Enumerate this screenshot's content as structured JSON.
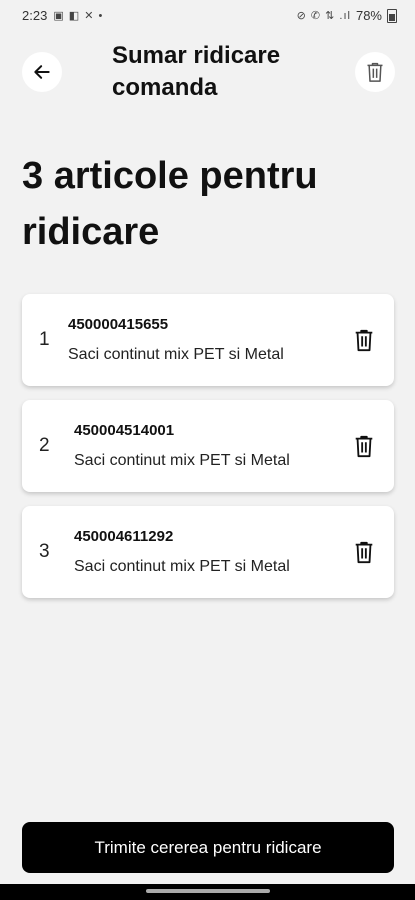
{
  "status_bar": {
    "time": "2:23",
    "icons_left": "▣ ◧ ✕ •",
    "icons_right": "⊘ ✆ ⇅ .ıl",
    "battery": "78%"
  },
  "header": {
    "title": "Sumar ridicare comanda",
    "back_icon": "arrow-left-icon",
    "delete_icon": "trash-icon"
  },
  "page_title": "3 articole pentru ridicare",
  "items": [
    {
      "index": "1",
      "code": "450000415655",
      "description": "Saci continut mix PET si Metal"
    },
    {
      "index": "2",
      "code": "450004514001",
      "description": "Saci continut mix PET si Metal"
    },
    {
      "index": "3",
      "code": "450004611292",
      "description": "Saci continut mix PET si Metal"
    }
  ],
  "submit_label": "Trimite cererea pentru ridicare"
}
